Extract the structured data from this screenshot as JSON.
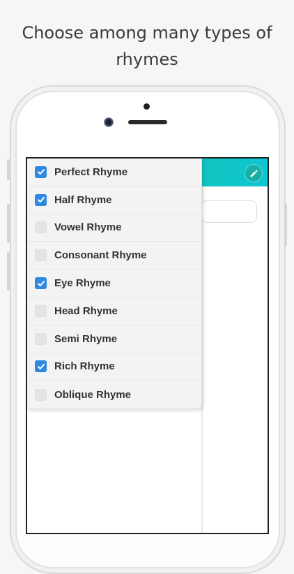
{
  "headline": {
    "line1": "Choose among many types of",
    "line2": "rhymes"
  },
  "colors": {
    "accent": "#2f89e0",
    "topbar_start": "#1ab394",
    "topbar_end": "#0ec6d3"
  },
  "toolbar": {
    "edit_icon": "pencil-icon"
  },
  "rhyme_types": [
    {
      "label": "Perfect Rhyme",
      "checked": true
    },
    {
      "label": "Half Rhyme",
      "checked": true
    },
    {
      "label": "Vowel Rhyme",
      "checked": false
    },
    {
      "label": "Consonant Rhyme",
      "checked": false
    },
    {
      "label": "Eye Rhyme",
      "checked": true
    },
    {
      "label": "Head Rhyme",
      "checked": false
    },
    {
      "label": "Semi Rhyme",
      "checked": false
    },
    {
      "label": "Rich Rhyme",
      "checked": true
    },
    {
      "label": "Oblique Rhyme",
      "checked": false
    }
  ]
}
